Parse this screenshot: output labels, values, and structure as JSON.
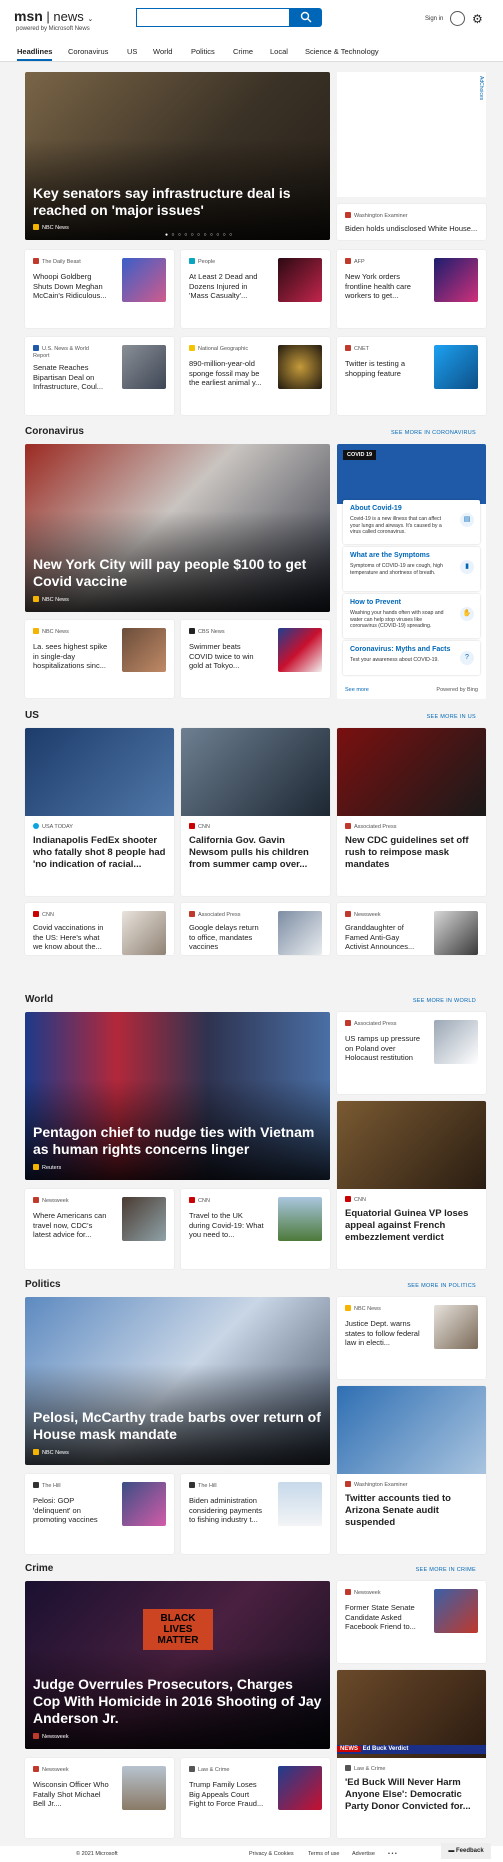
{
  "header": {
    "logo_msn": "msn",
    "logo_news": "news",
    "powered_by": "powered by Microsoft News",
    "sign_in": "Sign in",
    "search_placeholder": ""
  },
  "nav": {
    "items": [
      "Headlines",
      "Coronavirus",
      "US",
      "World",
      "Politics",
      "Crime",
      "Local",
      "Science & Technology"
    ]
  },
  "ad_label": "AdChoices",
  "top": {
    "hero": {
      "title": "Key senators say infrastructure deal is reached on 'major issues'",
      "source": "NBC News",
      "dots": "● ○ ○ ○ ○ ○ ○ ○ ○ ○ ○"
    },
    "side": {
      "source": "Washington Examiner",
      "title": "Biden holds undisclosed White House..."
    },
    "cards": [
      {
        "source": "The Daily Beast",
        "title": "Whoopi Goldberg Shuts Down Meghan McCain's Ridiculous..."
      },
      {
        "source": "People",
        "title": "At Least 2 Dead and Dozens Injured in 'Mass Casualty'..."
      },
      {
        "source": "AFP",
        "title": "New York orders frontline health care workers to get..."
      },
      {
        "source": "U.S. News & World Report",
        "title": "Senate Reaches Bipartisan Deal on Infrastructure, Coul..."
      },
      {
        "source": "National Geographic",
        "title": "890-million-year-old sponge fossil may be the earliest animal y..."
      },
      {
        "source": "CNET",
        "title": "Twitter is testing a shopping feature"
      }
    ]
  },
  "coronavirus": {
    "heading": "Coronavirus",
    "see_more": "SEE MORE IN CORONAVIRUS",
    "hero": {
      "title": "New York City will pay people $100 to get Covid vaccine",
      "source": "NBC News"
    },
    "cards": [
      {
        "source": "NBC News",
        "title": "La. sees highest spike in single-day hospitalizations sinc..."
      },
      {
        "source": "CBS News",
        "title": "Swimmer beats COVID twice to win gold at Tokyo..."
      }
    ],
    "panel": {
      "tag": "COVID 19",
      "see_more": "See more",
      "powered": "Powered by Bing",
      "items": [
        {
          "title": "About Covid-19",
          "desc": "Covid-19 is a new illness that can affect your lungs and airways. It's caused by a virus called coronavirus."
        },
        {
          "title": "What are the Symptoms",
          "desc": "Symptoms of COVID-19 are cough, high temperature and shortness of breath."
        },
        {
          "title": "How to Prevent",
          "desc": "Washing your hands often with soap and water can help stop viruses like coronavirus (COVID-19) spreading."
        },
        {
          "title": "Coronavirus: Myths and Facts",
          "desc": "Test your awareness about COVID-19."
        }
      ]
    }
  },
  "us": {
    "heading": "US",
    "see_more": "SEE MORE IN US",
    "big": [
      {
        "source": "USA TODAY",
        "title": "Indianapolis FedEx shooter who fatally shot 8 people had 'no indication of racial..."
      },
      {
        "source": "CNN",
        "title": "California Gov. Gavin Newsom pulls his children from summer camp over..."
      },
      {
        "source": "Associated Press",
        "title": "New CDC guidelines set off rush to reimpose mask mandates"
      }
    ],
    "cards": [
      {
        "source": "CNN",
        "title": "Covid vaccinations in the US: Here's what we know about the..."
      },
      {
        "source": "Associated Press",
        "title": "Google delays return to office, mandates vaccines"
      },
      {
        "source": "Newsweek",
        "title": "Granddaughter of Famed Anti-Gay Activist Announces..."
      }
    ]
  },
  "world": {
    "heading": "World",
    "see_more": "SEE MORE IN WORLD",
    "hero": {
      "title": "Pentagon chief to nudge ties with Vietnam as human rights concerns linger",
      "source": "Reuters"
    },
    "side": {
      "source": "Associated Press",
      "title": "US ramps up pressure on Poland over Holocaust restitution"
    },
    "big": {
      "source": "CNN",
      "title": "Equatorial Guinea VP loses appeal against French embezzlement verdict"
    },
    "cards": [
      {
        "source": "Newsweek",
        "title": "Where Americans can travel now, CDC's latest advice for..."
      },
      {
        "source": "CNN",
        "title": "Travel to the UK during Covid-19: What you need to..."
      }
    ]
  },
  "politics": {
    "heading": "Politics",
    "see_more": "SEE MORE IN POLITICS",
    "hero": {
      "title": "Pelosi, McCarthy trade barbs over return of House mask mandate",
      "source": "NBC News"
    },
    "side": {
      "source": "NBC News",
      "title": "Justice Dept. warns states to follow federal law in electi..."
    },
    "big": {
      "source": "Washington Examiner",
      "title": "Twitter accounts tied to Arizona Senate audit suspended"
    },
    "cards": [
      {
        "source": "The Hill",
        "title": "Pelosi: GOP 'delinquent' on promoting vaccines"
      },
      {
        "source": "The Hill",
        "title": "Biden administration considering payments to fishing industry t..."
      }
    ]
  },
  "crime": {
    "heading": "Crime",
    "see_more": "SEE MORE IN CRIME",
    "hero": {
      "title": "Judge Overrules Prosecutors, Charges Cop With Homicide in 2016 Shooting of Jay Anderson Jr.",
      "source": "Newsweek",
      "sign": "BLACK LIVES MATTER"
    },
    "side": {
      "source": "Newsweek",
      "title": "Former State Senate Candidate Asked Facebook Friend to..."
    },
    "big": {
      "source": "Law & Crime",
      "title": "'Ed Buck Will Never Harm Anyone Else': Democratic Party Donor Convicted for...",
      "banner": "Ed Buck Verdict",
      "banner_tag": "NEWS"
    },
    "cards": [
      {
        "source": "Newsweek",
        "title": "Wisconsin Officer Who Fatally Shot Michael Bell Jr...."
      },
      {
        "source": "Law & Crime",
        "title": "Trump Family Loses Big Appeals Court Fight to Force Fraud..."
      }
    ]
  },
  "footer": {
    "copyright": "© 2021 Microsoft",
    "privacy": "Privacy & Cookies",
    "terms": "Terms of use",
    "advertise": "Advertise",
    "more": "• • •",
    "feedback": "Feedback"
  }
}
